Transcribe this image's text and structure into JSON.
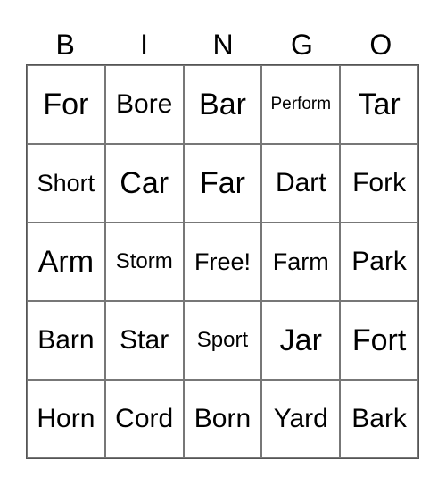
{
  "header": [
    "B",
    "I",
    "N",
    "G",
    "O"
  ],
  "cells": [
    [
      "For",
      "Bore",
      "Bar",
      "Perform",
      "Tar"
    ],
    [
      "Short",
      "Car",
      "Far",
      "Dart",
      "Fork"
    ],
    [
      "Arm",
      "Storm",
      "Free!",
      "Farm",
      "Park"
    ],
    [
      "Barn",
      "Star",
      "Sport",
      "Jar",
      "Fort"
    ],
    [
      "Horn",
      "Cord",
      "Born",
      "Yard",
      "Bark"
    ]
  ]
}
